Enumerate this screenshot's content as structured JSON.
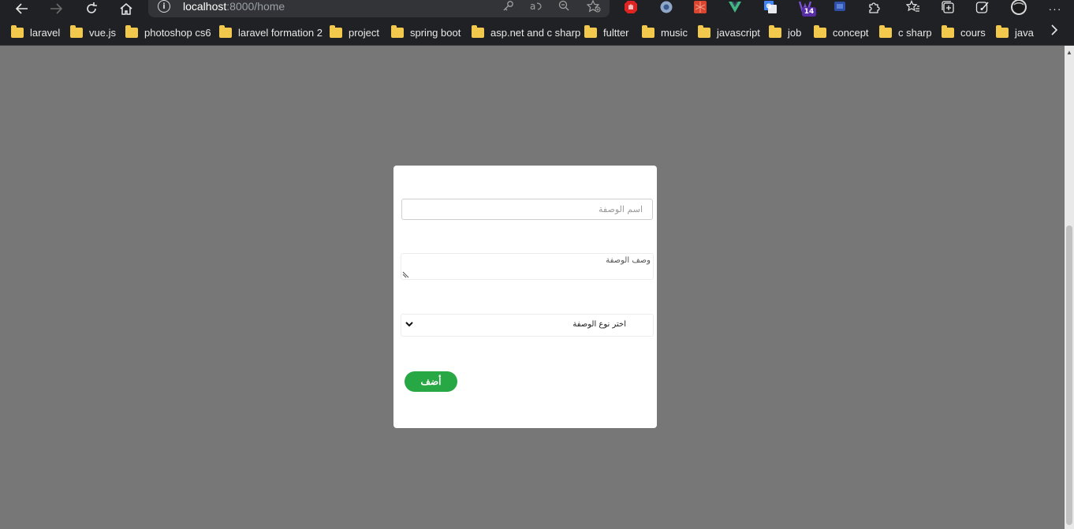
{
  "browser": {
    "url_host": "localhost",
    "url_rest": ":8000/home",
    "bookmarks": [
      "laravel",
      "vue.js",
      "photoshop cs6",
      "laravel formation 2",
      "project",
      "spring boot",
      "asp.net and c sharp",
      "fultter",
      "music",
      "javascript",
      "job",
      "concept",
      "c sharp",
      "cours",
      "java"
    ],
    "extension_badge": "14",
    "more_label": "···"
  },
  "form": {
    "name_placeholder": "اسم الوصفة",
    "description_placeholder": "وصف الوصفة",
    "type_select_value": "اختر نوع الوصفة",
    "submit_label": "أضف"
  },
  "colors": {
    "page_background": "#777777",
    "card_background": "#ffffff",
    "submit_button": "#28a745",
    "browser_chrome": "#202124"
  }
}
